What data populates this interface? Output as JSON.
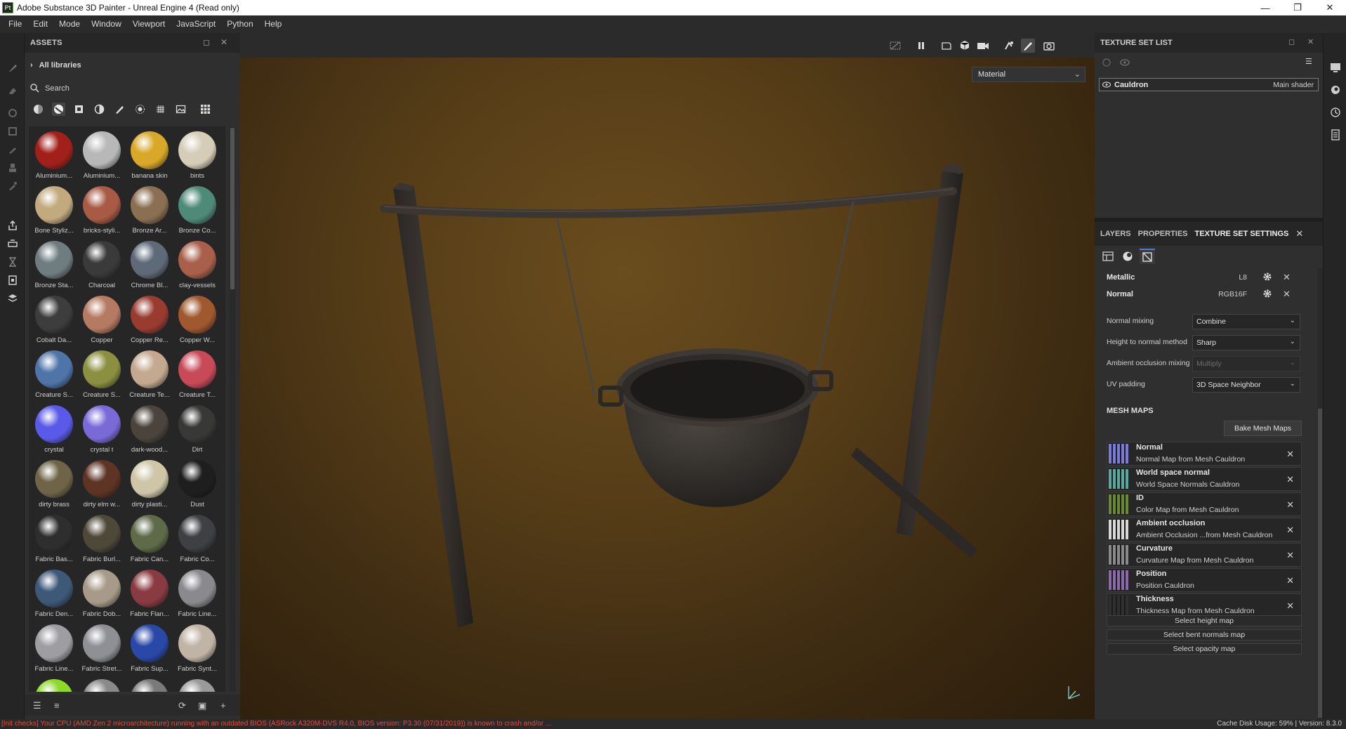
{
  "window": {
    "app_icon": "Pt",
    "title": "Adobe Substance 3D Painter - Unreal Engine 4 (Read only)",
    "controls": [
      "minimize-icon",
      "restore-icon",
      "close-icon"
    ]
  },
  "menu": [
    "File",
    "Edit",
    "Mode",
    "Window",
    "Viewport",
    "JavaScript",
    "Python",
    "Help"
  ],
  "tools": [
    "paint-brush-icon",
    "eraser-icon",
    "projection-icon",
    "polygon-fill-icon",
    "smudge-icon",
    "clone-icon",
    "color-picker-icon",
    "export-icon",
    "bake-icon",
    "iray-icon",
    "document-icon",
    "shelf-icon"
  ],
  "assets": {
    "title": "ASSETS",
    "library": "All libraries",
    "search_placeholder": "Search",
    "filters": [
      "materials",
      "smart-materials",
      "textures",
      "filters",
      "brushes",
      "particles",
      "alphas",
      "environments",
      "grid-view"
    ],
    "items": [
      {
        "label": "Aluminium...",
        "color": "#a2201a"
      },
      {
        "label": "Aluminium...",
        "color": "#b8b8b8"
      },
      {
        "label": "banana skin",
        "color": "#d9a828"
      },
      {
        "label": "bints",
        "color": "#d6cdb8"
      },
      {
        "label": "Bone Styliz...",
        "color": "#c3a97e"
      },
      {
        "label": "bricks-styli...",
        "color": "#a85a44"
      },
      {
        "label": "Bronze Ar...",
        "color": "#8a6f52"
      },
      {
        "label": "Bronze Co...",
        "color": "#4f8a78"
      },
      {
        "label": "Bronze Sta...",
        "color": "#6f7d80"
      },
      {
        "label": "Charcoal",
        "color": "#3a3a3a"
      },
      {
        "label": "Chrome Bl...",
        "color": "#5f6a78"
      },
      {
        "label": "clay-vessels",
        "color": "#a8604a"
      },
      {
        "label": "Cobalt Da...",
        "color": "#3d3d3d"
      },
      {
        "label": "Copper",
        "color": "#b57a62"
      },
      {
        "label": "Copper Re...",
        "color": "#9a3b30"
      },
      {
        "label": "Copper W...",
        "color": "#a0582e"
      },
      {
        "label": "Creature S...",
        "color": "#4f74a8"
      },
      {
        "label": "Creature S...",
        "color": "#8a9040"
      },
      {
        "label": "Creature Te...",
        "color": "#c4a890"
      },
      {
        "label": "Creature T...",
        "color": "#c84a58"
      },
      {
        "label": "crystal",
        "color": "#5a5ae8"
      },
      {
        "label": "crystal t",
        "color": "#7a6ad8"
      },
      {
        "label": "dark-wood...",
        "color": "#4a443c"
      },
      {
        "label": "Dirt",
        "color": "#383836"
      },
      {
        "label": "dirty brass",
        "color": "#6f6448"
      },
      {
        "label": "dirty elm w...",
        "color": "#5e3424"
      },
      {
        "label": "dirty plasti...",
        "color": "#cfc6a8"
      },
      {
        "label": "Dust",
        "color": "#1e1e1e"
      },
      {
        "label": "Fabric Bas...",
        "color": "#2e2e2e"
      },
      {
        "label": "Fabric Burl...",
        "color": "#4e4838"
      },
      {
        "label": "Fabric Can...",
        "color": "#5e6a48"
      },
      {
        "label": "Fabric Co...",
        "color": "#3e4044"
      },
      {
        "label": "Fabric Den...",
        "color": "#3e5878"
      },
      {
        "label": "Fabric Dob...",
        "color": "#a89a88"
      },
      {
        "label": "Fabric Flan...",
        "color": "#8a3a42"
      },
      {
        "label": "Fabric Line...",
        "color": "#8a8a8e"
      },
      {
        "label": "Fabric Line...",
        "color": "#9e9ea2"
      },
      {
        "label": "Fabric Stret...",
        "color": "#8e9096"
      },
      {
        "label": "Fabric Sup...",
        "color": "#2a48a8"
      },
      {
        "label": "Fabric Synt...",
        "color": "#c0b4a6"
      },
      {
        "label": "",
        "color": "#8ed82a"
      },
      {
        "label": "",
        "color": "#8a8a8a"
      },
      {
        "label": "",
        "color": "#7a7a7a"
      },
      {
        "label": "",
        "color": "#9a9a9a"
      }
    ],
    "footer": [
      "filter-list-icon",
      "list-view-icon",
      "refresh-icon",
      "folder-icon",
      "add-icon"
    ]
  },
  "viewport": {
    "toolbar": [
      "hide-icon",
      "pause-icon",
      "view-2d-icon",
      "view-3d-icon",
      "camera-icon",
      "symmetry-icon",
      "paint-mode-icon",
      "screenshot-icon"
    ],
    "channel_select": "Material"
  },
  "texture_set_list": {
    "title": "TEXTURE SET LIST",
    "item": {
      "name": "Cauldron",
      "shader": "Main shader"
    }
  },
  "right_strip": [
    "display-settings-icon",
    "shader-settings-icon",
    "history-icon",
    "log-icon"
  ],
  "panel": {
    "tabs": [
      "LAYERS",
      "PROPERTIES",
      "TEXTURE SET SETTINGS"
    ],
    "channels": [
      {
        "name": "Metallic",
        "format": "L8"
      },
      {
        "name": "Normal",
        "format": "RGB16F"
      }
    ],
    "properties": [
      {
        "label": "Normal mixing",
        "value": "Combine",
        "disabled": false
      },
      {
        "label": "Height to normal method",
        "value": "Sharp",
        "disabled": false
      },
      {
        "label": "Ambient occlusion mixing",
        "value": "Multiply",
        "disabled": true
      },
      {
        "label": "UV padding",
        "value": "3D Space Neighbor",
        "disabled": false
      }
    ],
    "mesh_maps_title": "MESH MAPS",
    "bake_button": "Bake Mesh Maps",
    "mesh_maps": [
      {
        "name": "Normal",
        "source": "Normal Map from Mesh Cauldron"
      },
      {
        "name": "World space normal",
        "source": "World Space Normals Cauldron"
      },
      {
        "name": "ID",
        "source": "Color Map from Mesh Cauldron"
      },
      {
        "name": "Ambient occlusion",
        "source": "Ambient Occlusion ...from Mesh Cauldron"
      },
      {
        "name": "Curvature",
        "source": "Curvature Map from Mesh Cauldron"
      },
      {
        "name": "Position",
        "source": "Position Cauldron"
      },
      {
        "name": "Thickness",
        "source": "Thickness Map from Mesh Cauldron"
      }
    ],
    "select_buttons": [
      "Select height map",
      "Select bent normals map",
      "Select opacity map"
    ]
  },
  "status": {
    "message": "[Init checks] Your CPU (AMD Zen 2 microarchitecture) running with an outdated BIOS (ASRock A320M-DVS R4.0, BIOS version: P3.30 (07/31/2019)) is known to crash and/or ...",
    "cache": "Cache Disk Usage:  59%  |  Version: 8.3.0"
  }
}
